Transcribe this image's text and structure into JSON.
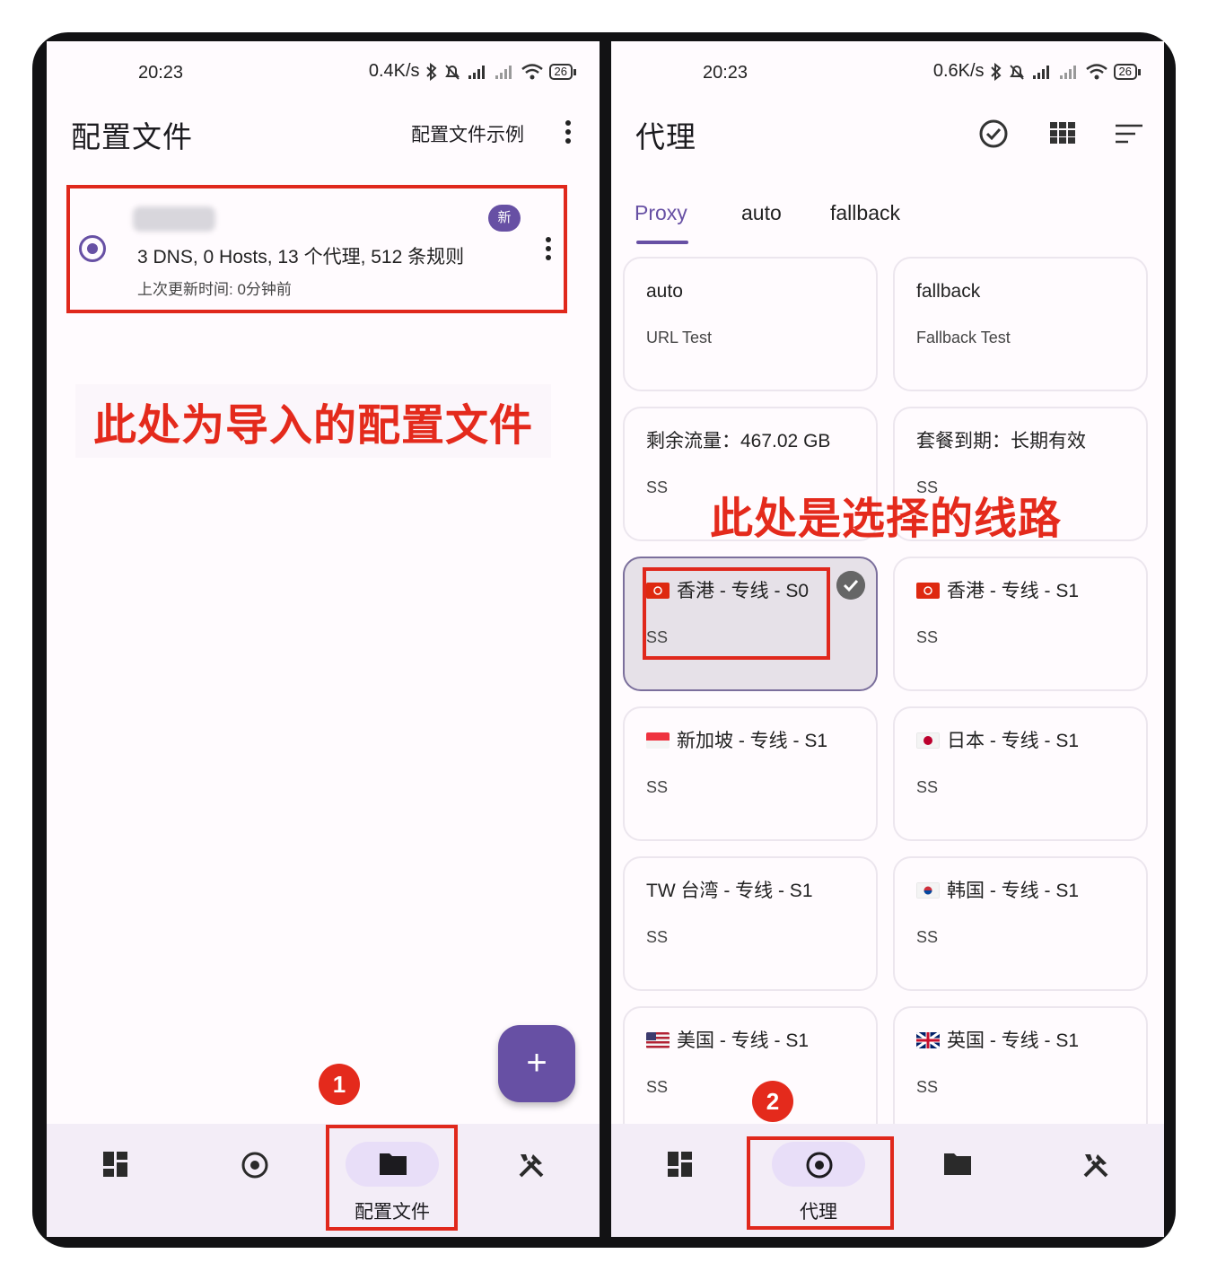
{
  "left": {
    "status": {
      "time": "20:23",
      "speed": "0.4K/s",
      "battery": "26"
    },
    "appbar": {
      "title": "配置文件",
      "action": "配置文件示例"
    },
    "profile": {
      "badge": "新",
      "summary": "3 DNS, 0 Hosts, 13 个代理, 512 条规则",
      "updated": "上次更新时间: 0分钟前"
    },
    "annotation": "此处为导入的配置文件",
    "fab": "+",
    "marker": "1",
    "nav": {
      "active_label": "配置文件"
    }
  },
  "right": {
    "status": {
      "time": "20:23",
      "speed": "0.6K/s",
      "battery": "26"
    },
    "appbar": {
      "title": "代理"
    },
    "tabs": [
      "Proxy",
      "auto",
      "fallback"
    ],
    "annotation": "此处是选择的线路",
    "marker": "2",
    "nav": {
      "active_label": "代理"
    },
    "cards": [
      {
        "name": "auto",
        "type": "URL Test",
        "flag": ""
      },
      {
        "name": "fallback",
        "type": "Fallback Test",
        "flag": ""
      },
      {
        "name": "剩余流量：467.02 GB",
        "type": "SS",
        "flag": ""
      },
      {
        "name": "套餐到期：长期有效",
        "type": "SS",
        "flag": ""
      },
      {
        "name": "香港 - 专线 - S0",
        "type": "SS",
        "flag": "hk"
      },
      {
        "name": "香港 - 专线 - S1",
        "type": "SS",
        "flag": "hk"
      },
      {
        "name": "新加坡 - 专线 - S1",
        "type": "SS",
        "flag": "sg"
      },
      {
        "name": "日本 - 专线 - S1",
        "type": "SS",
        "flag": "jp"
      },
      {
        "name": "TW 台湾 - 专线 - S1",
        "type": "SS",
        "flag": ""
      },
      {
        "name": "韩国 - 专线 - S1",
        "type": "SS",
        "flag": "kr"
      },
      {
        "name": "美国 - 专线 - S1",
        "type": "SS",
        "flag": "us"
      },
      {
        "name": "英国 - 专线 - S1",
        "type": "SS",
        "flag": "uk"
      }
    ]
  },
  "colors": {
    "primary": "#6750a4",
    "annotation_red": "#e42a1c",
    "selected_card": "#e6e1e8"
  }
}
